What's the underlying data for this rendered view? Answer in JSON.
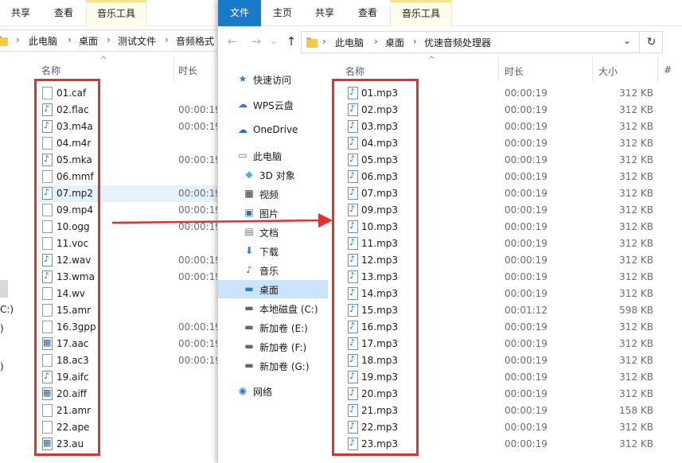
{
  "back_window": {
    "tabs": [
      "共享",
      "查看",
      "音乐工具"
    ],
    "breadcrumb": [
      "此电脑",
      "桌面",
      "测试文件",
      "音频格式"
    ],
    "columns": {
      "name": "名称",
      "duration": "时长"
    },
    "files": [
      {
        "name": "01.caf",
        "duration": "",
        "icon": "generic-file-icon"
      },
      {
        "name": "02.flac",
        "duration": "00:00:19",
        "icon": "audio-file-icon"
      },
      {
        "name": "03.m4a",
        "duration": "00:00:19",
        "icon": "audio-file-icon"
      },
      {
        "name": "04.m4r",
        "duration": "",
        "icon": "generic-file-icon"
      },
      {
        "name": "05.mka",
        "duration": "00:00:19",
        "icon": "audio-file-icon"
      },
      {
        "name": "06.mmf",
        "duration": "",
        "icon": "generic-file-icon"
      },
      {
        "name": "07.mp2",
        "duration": "00:00:19",
        "icon": "audio-file-icon"
      },
      {
        "name": "09.mp4",
        "duration": "00:00:19",
        "icon": "generic-file-icon"
      },
      {
        "name": "10.ogg",
        "duration": "00:00:19",
        "icon": "generic-file-icon"
      },
      {
        "name": "11.voc",
        "duration": "",
        "icon": "generic-file-icon"
      },
      {
        "name": "12.wav",
        "duration": "00:00:19",
        "icon": "audio-file-icon"
      },
      {
        "name": "13.wma",
        "duration": "00:00:19",
        "icon": "audio-file-icon"
      },
      {
        "name": "14.wv",
        "duration": "",
        "icon": "generic-file-icon"
      },
      {
        "name": "15.amr",
        "duration": "",
        "icon": "generic-file-icon"
      },
      {
        "name": "16.3gpp",
        "duration": "00:00:19",
        "icon": "generic-file-icon"
      },
      {
        "name": "17.aac",
        "duration": "00:00:19",
        "icon": "video-file-icon"
      },
      {
        "name": "18.ac3",
        "duration": "00:00:19",
        "icon": "generic-file-icon"
      },
      {
        "name": "19.aifc",
        "duration": "",
        "icon": "audio-file-icon"
      },
      {
        "name": "20.aiff",
        "duration": "",
        "icon": "video-file-icon"
      },
      {
        "name": "21.amr",
        "duration": "",
        "icon": "generic-file-icon"
      },
      {
        "name": "22.ape",
        "duration": "",
        "icon": "generic-file-icon"
      },
      {
        "name": "23.au",
        "duration": "",
        "icon": "video-file-icon"
      }
    ],
    "partial_nav": [
      "C:)",
      ")",
      ")"
    ]
  },
  "front_window": {
    "tabs": [
      "文件",
      "主页",
      "共享",
      "查看",
      "音乐工具"
    ],
    "breadcrumb": [
      "此电脑",
      "桌面",
      "优速音频处理器"
    ],
    "nav_buttons": {
      "back": "←",
      "forward": "→",
      "recent": "⌄",
      "up": "↑",
      "address_dropdown": "⌄",
      "refresh": "↻"
    },
    "columns": {
      "name": "名称",
      "duration": "时长",
      "size": "大小",
      "extra": "#"
    },
    "nav_pane": [
      {
        "label": "快速访问",
        "icon": "star-icon"
      },
      {
        "label": "WPS云盘",
        "icon": "cloud-icon"
      },
      {
        "label": "OneDrive",
        "icon": "onedrive-icon"
      },
      {
        "label": "此电脑",
        "icon": "computer-icon"
      },
      {
        "label": "3D 对象",
        "icon": "cube-icon"
      },
      {
        "label": "视频",
        "icon": "video-icon"
      },
      {
        "label": "图片",
        "icon": "picture-icon"
      },
      {
        "label": "文档",
        "icon": "document-icon"
      },
      {
        "label": "下载",
        "icon": "download-icon"
      },
      {
        "label": "音乐",
        "icon": "music-icon"
      },
      {
        "label": "桌面",
        "icon": "desktop-icon"
      },
      {
        "label": "本地磁盘 (C:)",
        "icon": "drive-icon"
      },
      {
        "label": "新加卷 (E:)",
        "icon": "drive-icon"
      },
      {
        "label": "新加卷 (F:)",
        "icon": "drive-icon"
      },
      {
        "label": "新加卷 (G:)",
        "icon": "drive-icon"
      },
      {
        "label": "网络",
        "icon": "network-icon"
      }
    ],
    "files": [
      {
        "name": "01.mp3",
        "duration": "00:00:19",
        "size": "312 KB"
      },
      {
        "name": "02.mp3",
        "duration": "00:00:19",
        "size": "312 KB"
      },
      {
        "name": "03.mp3",
        "duration": "00:00:19",
        "size": "312 KB"
      },
      {
        "name": "04.mp3",
        "duration": "00:00:19",
        "size": "312 KB"
      },
      {
        "name": "05.mp3",
        "duration": "00:00:19",
        "size": "312 KB"
      },
      {
        "name": "06.mp3",
        "duration": "00:00:19",
        "size": "312 KB"
      },
      {
        "name": "07.mp3",
        "duration": "00:00:19",
        "size": "312 KB"
      },
      {
        "name": "09.mp3",
        "duration": "00:00:19",
        "size": "312 KB"
      },
      {
        "name": "10.mp3",
        "duration": "00:00:19",
        "size": "312 KB"
      },
      {
        "name": "11.mp3",
        "duration": "00:00:19",
        "size": "312 KB"
      },
      {
        "name": "12.mp3",
        "duration": "00:00:19",
        "size": "312 KB"
      },
      {
        "name": "13.mp3",
        "duration": "00:00:19",
        "size": "312 KB"
      },
      {
        "name": "14.mp3",
        "duration": "00:00:19",
        "size": "312 KB"
      },
      {
        "name": "15.mp3",
        "duration": "00:01:12",
        "size": "598 KB"
      },
      {
        "name": "16.mp3",
        "duration": "00:00:19",
        "size": "312 KB"
      },
      {
        "name": "17.mp3",
        "duration": "00:00:19",
        "size": "312 KB"
      },
      {
        "name": "18.mp3",
        "duration": "00:00:19",
        "size": "312 KB"
      },
      {
        "name": "19.mp3",
        "duration": "00:00:19",
        "size": "312 KB"
      },
      {
        "name": "20.mp3",
        "duration": "00:00:19",
        "size": "312 KB"
      },
      {
        "name": "21.mp3",
        "duration": "00:00:19",
        "size": "158 KB"
      },
      {
        "name": "22.mp3",
        "duration": "00:00:19",
        "size": "312 KB"
      },
      {
        "name": "23.mp3",
        "duration": "00:00:19",
        "size": "312 KB"
      }
    ]
  },
  "colors": {
    "annotation_red": "#e03030",
    "file_tab_blue": "#1979ca",
    "selection_blue": "#cce4f7",
    "header_text": "#4d6082"
  }
}
